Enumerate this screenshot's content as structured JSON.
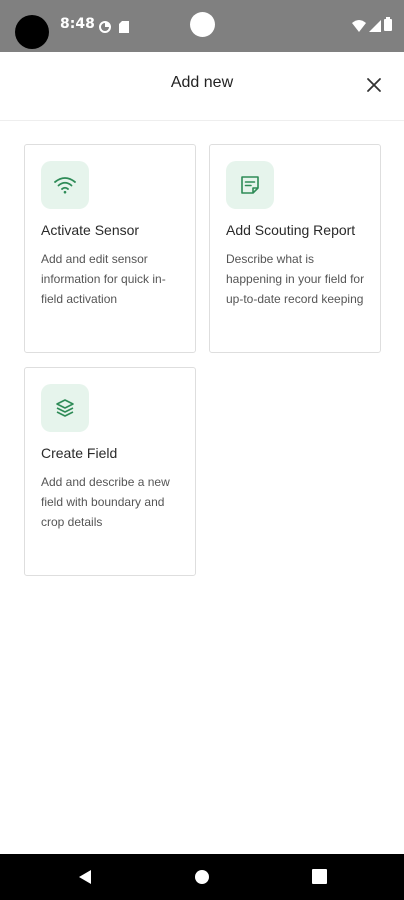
{
  "status_bar": {
    "time": "8:48",
    "icons": [
      "camera-cutout",
      "data-saver-icon",
      "sd-card-icon",
      "wifi-icon",
      "signal-icon",
      "battery-icon"
    ]
  },
  "header": {
    "title": "Add new",
    "close_icon": "close-icon"
  },
  "cards": [
    {
      "title": "Activate Sensor",
      "description": "Add and edit sensor information for quick in-field activation",
      "icon": "wifi-icon"
    },
    {
      "title": "Add Scouting Report",
      "description": "Describe what is happening in your field for up-to-date record keeping",
      "icon": "note-icon"
    },
    {
      "title": "Create Field",
      "description": "Add and describe a new field with boundary and crop details",
      "icon": "layers-icon"
    }
  ],
  "colors": {
    "accent": "#2e8b57",
    "icon_bg": "#e6f4ec",
    "status_bar": "#808080",
    "nav_bar": "#000000"
  },
  "nav": [
    "back-icon",
    "home-icon",
    "recents-icon"
  ]
}
